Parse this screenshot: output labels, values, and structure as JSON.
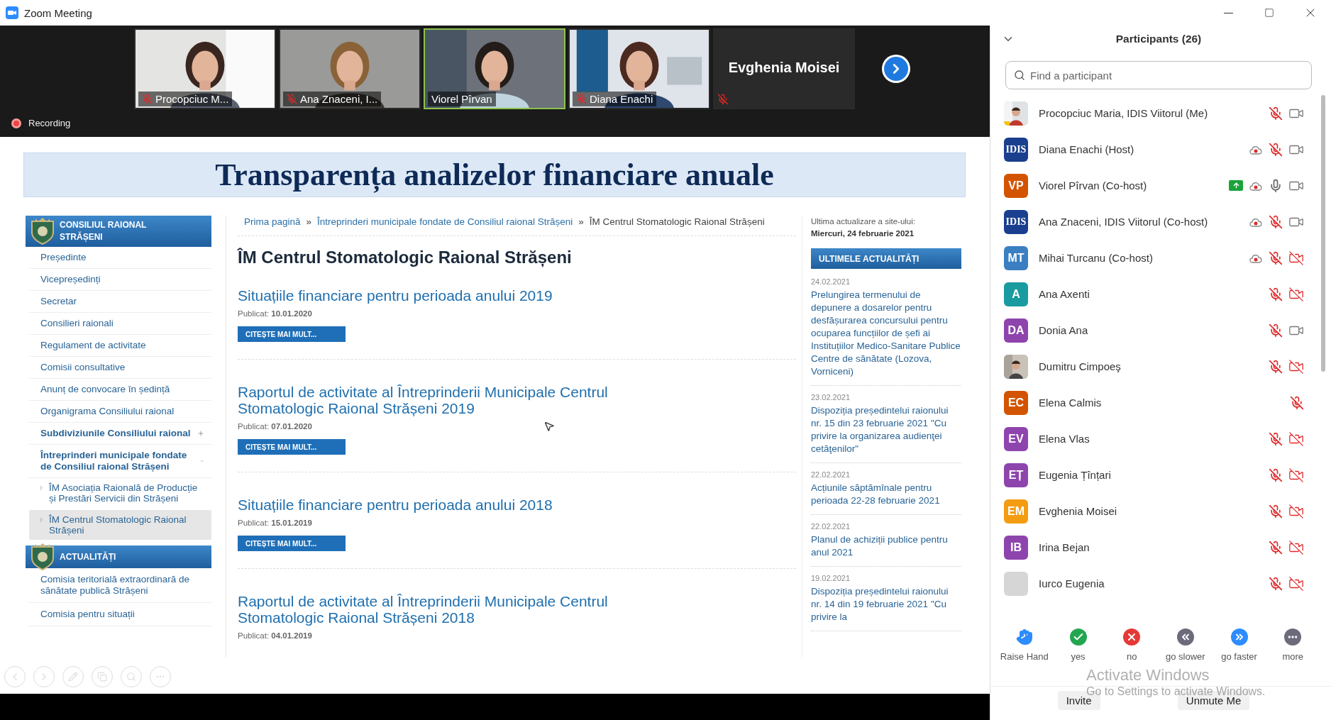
{
  "window": {
    "title": "Zoom Meeting"
  },
  "gallery": {
    "tiles": [
      {
        "kind": "video",
        "name": "Procopciuc M...",
        "muted": true,
        "speaking": false
      },
      {
        "kind": "video",
        "name": "Ana Znaceni, I...",
        "muted": true,
        "speaking": false
      },
      {
        "kind": "video",
        "name": "Viorel Pîrvan",
        "muted": false,
        "speaking": true
      },
      {
        "kind": "video",
        "name": "Diana Enachi",
        "muted": true,
        "speaking": false
      },
      {
        "kind": "name",
        "name": "Evghenia Moisei",
        "muted": true,
        "speaking": false
      }
    ]
  },
  "recording": {
    "label": "Recording"
  },
  "site": {
    "banner": "Transparența analizelor financiare anuale",
    "sidebar": {
      "header": "CONSILIUL RAIONAL STRĂȘENI",
      "items": [
        {
          "kind": "link",
          "label": "Președinte",
          "selected": false
        },
        {
          "kind": "link",
          "label": "Vicepreședinți",
          "selected": false
        },
        {
          "kind": "link",
          "label": "Secretar",
          "selected": false
        },
        {
          "kind": "link",
          "label": "Consilieri raionali",
          "selected": false
        },
        {
          "kind": "link",
          "label": "Regulament de activitate",
          "selected": false
        },
        {
          "kind": "link",
          "label": "Comisii consultative",
          "selected": false
        },
        {
          "kind": "link",
          "label": "Anunț de convocare în ședință",
          "selected": false
        },
        {
          "kind": "link",
          "label": "Organigrama Consiliului raional",
          "selected": false
        },
        {
          "kind": "group",
          "label": "Subdiviziunile Consiliului raional",
          "selected": false,
          "expanded": false
        },
        {
          "kind": "group",
          "label": "Întreprinderi municipale fondate de Consiliul raional Strășeni",
          "selected": false,
          "expanded": true,
          "children": [
            {
              "label": "ÎM Asociația Raională de Producție și Prestări Servicii din Strășeni",
              "selected": false
            },
            {
              "label": "ÎM Centrul Stomatologic Raional Strășeni",
              "selected": true
            }
          ]
        }
      ],
      "news_header": "ACTUALITĂȚI",
      "news_items": [
        "Comisia teritorială extraordinară de sănătate publică Strășeni",
        "Comisia pentru situații"
      ]
    },
    "breadcrumb": {
      "separator": "»",
      "items": [
        {
          "label": "Prima pagină",
          "link": true
        },
        {
          "label": "Întreprinderi municipale fondate de Consiliul raional Strășeni",
          "link": true
        },
        {
          "label": "ÎM Centrul Stomatologic Raional Strășeni",
          "link": false
        }
      ]
    },
    "page_title": "ÎM Centrul Stomatologic Raional Strășeni",
    "articles": [
      {
        "title": "Situațiile financiare pentru perioada anului 2019",
        "published_label": "Publicat:",
        "date": "10.01.2020",
        "button": "CITEȘTE MAI MULT..."
      },
      {
        "title": "Raportul de activitate al Întreprinderii Municipale Centrul Stomatologic Raional Strășeni 2019",
        "published_label": "Publicat:",
        "date": "07.01.2020",
        "button": "CITEȘTE MAI MULT..."
      },
      {
        "title": "Situațiile financiare pentru perioada anului 2018",
        "published_label": "Publicat:",
        "date": "15.01.2019",
        "button": "CITEȘTE MAI MULT..."
      },
      {
        "title": "Raportul de activitate al Întreprinderii Municipale Centrul Stomatologic Raional Strășeni 2018",
        "published_label": "Publicat:",
        "date": "04.01.2019"
      }
    ],
    "update": {
      "label": "Ultima actualizare a site-ului:",
      "date": "Miercuri, 24 februarie 2021"
    },
    "latest_header": "ULTIMELE ACTUALITĂȚI",
    "latest": [
      {
        "date": "24.02.2021",
        "title": "Prelungirea termenului de depunere a dosarelor pentru desfășurarea concursului pentru ocuparea funcțiilor de șefi ai Instituțiilor Medico-Sanitare Publice Centre de sănătate (Lozova, Vorniceni)"
      },
      {
        "date": "23.02.2021",
        "title": "Dispoziția președintelui raionului nr. 15 din 23 februarie 2021 \"Cu privire la organizarea audienţei cetăţenilor\""
      },
      {
        "date": "22.02.2021",
        "title": "Acțiunile săptămînale pentru perioada 22-28 februarie 2021"
      },
      {
        "date": "22.02.2021",
        "title": "Planul de achiziții publice pentru anul 2021"
      },
      {
        "date": "19.02.2021",
        "title": "Dispoziția președintelui raionului nr. 14 din 19 februarie 2021 \"Cu privire la"
      }
    ]
  },
  "participants": {
    "title": "Participants (26)",
    "search": {
      "placeholder": "Find a participant"
    },
    "list": [
      {
        "name": "Procopciuc Maria, IDIS Viitorul (Me)",
        "sharing": false,
        "recording": false,
        "muted": true,
        "video": true
      },
      {
        "name": "Diana Enachi (Host)",
        "avatar": {
          "kind": "logo",
          "text": "IDIS"
        },
        "sharing": false,
        "recording": true,
        "muted": true,
        "video": true
      },
      {
        "name": "Viorel Pîrvan (Co-host)",
        "avatar": {
          "kind": "initials",
          "text": "VP",
          "color": "#d35400"
        },
        "sharing": true,
        "recording": true,
        "muted": false,
        "video": true
      },
      {
        "name": "Ana Znaceni, IDIS Viitorul (Co-host)",
        "avatar": {
          "kind": "logo",
          "text": "IDIS"
        },
        "sharing": false,
        "recording": true,
        "muted": true,
        "video": true
      },
      {
        "name": "Mihai Turcanu (Co-host)",
        "avatar": {
          "kind": "initials",
          "text": "MT",
          "color": "#3a7fc1"
        },
        "sharing": false,
        "recording": true,
        "muted": true,
        "video": false
      },
      {
        "name": "Ana Axenti",
        "avatar": {
          "kind": "initials",
          "text": "A",
          "color": "#1a9ba0"
        },
        "sharing": false,
        "recording": false,
        "muted": true,
        "video": false
      },
      {
        "name": "Donia Ana",
        "avatar": {
          "kind": "initials",
          "text": "DA",
          "color": "#8e44ad"
        },
        "sharing": false,
        "recording": false,
        "muted": true,
        "video": true
      },
      {
        "name": "Dumitru Cimpoeş",
        "sharing": false,
        "recording": false,
        "muted": true,
        "video": false
      },
      {
        "name": "Elena Calmis",
        "avatar": {
          "kind": "initials",
          "text": "EC",
          "color": "#d35400"
        },
        "sharing": false,
        "recording": false,
        "muted": true
      },
      {
        "name": "Elena Vlas",
        "avatar": {
          "kind": "initials",
          "text": "EV",
          "color": "#8e44ad"
        },
        "sharing": false,
        "recording": false,
        "muted": true,
        "video": false
      },
      {
        "name": "Eugenia Țînțari",
        "avatar": {
          "kind": "initials",
          "text": "EȚ",
          "color": "#8e44ad"
        },
        "sharing": false,
        "recording": false,
        "muted": true,
        "video": false
      },
      {
        "name": "Evghenia Moisei",
        "avatar": {
          "kind": "initials",
          "text": "EM",
          "color": "#f39c12"
        },
        "sharing": false,
        "recording": false,
        "muted": true,
        "video": false
      },
      {
        "name": "Irina Bejan",
        "avatar": {
          "kind": "initials",
          "text": "IB",
          "color": "#8e44ad"
        },
        "sharing": false,
        "recording": false,
        "muted": true,
        "video": false
      },
      {
        "name": "Iurco Eugenia",
        "avatar": {
          "kind": "blank"
        },
        "sharing": false,
        "recording": false,
        "muted": true,
        "video": false
      }
    ],
    "reactions": [
      {
        "kind": "hand",
        "label": "Raise Hand"
      },
      {
        "kind": "yes",
        "label": "yes"
      },
      {
        "kind": "no",
        "label": "no"
      },
      {
        "kind": "slower",
        "label": "go slower"
      },
      {
        "kind": "faster",
        "label": "go faster"
      },
      {
        "kind": "more",
        "label": "more"
      }
    ],
    "buttons": [
      "Invite",
      "Unmute Me"
    ]
  },
  "os_notice": {
    "title": "Activate Windows",
    "subtitle": "Go to Settings to activate Windows."
  }
}
